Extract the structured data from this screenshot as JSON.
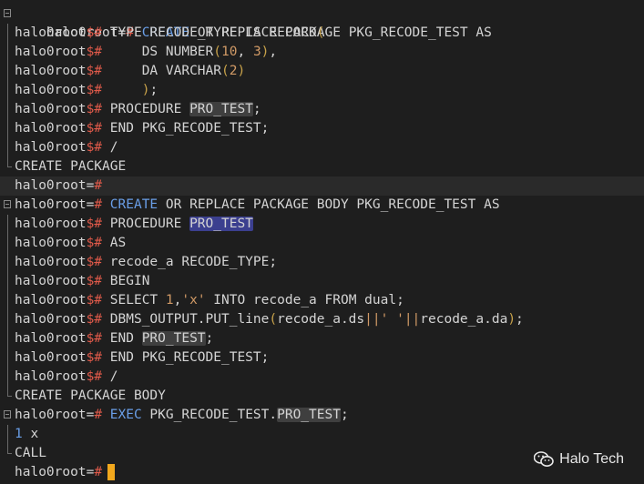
{
  "terminal": {
    "prompt_user": "halo0root",
    "prompt_hash": "#",
    "prompt_cont": "$#",
    "lines": [
      {
        "prompt": "halo0root=#",
        "text": " CREATE OR REPLACE PACKAGE PKG_RECODE_TEST AS"
      },
      {
        "prompt": "halo0root$#",
        "text": " TYPE RECODE_TYPE IS RECORD("
      },
      {
        "prompt": "halo0root$#",
        "text": "     DS NUMBER(10, 3),"
      },
      {
        "prompt": "halo0root$#",
        "text": "     DA VARCHAR(2)"
      },
      {
        "prompt": "halo0root$#",
        "text": "     );"
      },
      {
        "prompt": "halo0root$#",
        "text": " PROCEDURE PRO_TEST;"
      },
      {
        "prompt": "halo0root$#",
        "text": " END PKG_RECODE_TEST;"
      },
      {
        "prompt": "halo0root$#",
        "text": " /"
      },
      {
        "prompt": "",
        "text": "CREATE PACKAGE"
      },
      {
        "prompt": "halo0root=#",
        "text": ""
      },
      {
        "prompt": "halo0root=#",
        "text": " CREATE OR REPLACE PACKAGE BODY PKG_RECODE_TEST AS"
      },
      {
        "prompt": "halo0root$#",
        "text": " PROCEDURE PRO_TEST"
      },
      {
        "prompt": "halo0root$#",
        "text": " AS"
      },
      {
        "prompt": "halo0root$#",
        "text": " recode_a RECODE_TYPE;"
      },
      {
        "prompt": "halo0root$#",
        "text": " BEGIN"
      },
      {
        "prompt": "halo0root$#",
        "text": " SELECT 1,'x' INTO recode_a FROM dual;"
      },
      {
        "prompt": "halo0root$#",
        "text": " DBMS_OUTPUT.PUT_line(recode_a.ds||' '||recode_a.da);"
      },
      {
        "prompt": "halo0root$#",
        "text": " END PRO_TEST;"
      },
      {
        "prompt": "halo0root$#",
        "text": " END PKG_RECODE_TEST;"
      },
      {
        "prompt": "halo0root$#",
        "text": " /"
      },
      {
        "prompt": "",
        "text": "CREATE PACKAGE BODY"
      },
      {
        "prompt": "halo0root=#",
        "text": " EXEC PKG_RECODE_TEST.PRO_TEST;"
      },
      {
        "prompt": "",
        "text": "1 x"
      },
      {
        "prompt": "",
        "text": "CALL"
      },
      {
        "prompt": "halo0root=#",
        "text": ""
      }
    ]
  },
  "watermark": {
    "text": "Halo Tech",
    "icon": "wechat-icon"
  },
  "colors": {
    "background": "#1e1e1e",
    "keyword": "#6a9fe8",
    "number": "#d19a66",
    "prompt_hash": "#e05a4a",
    "cursor": "#f2a81d",
    "selection": "#3b3f8f"
  }
}
